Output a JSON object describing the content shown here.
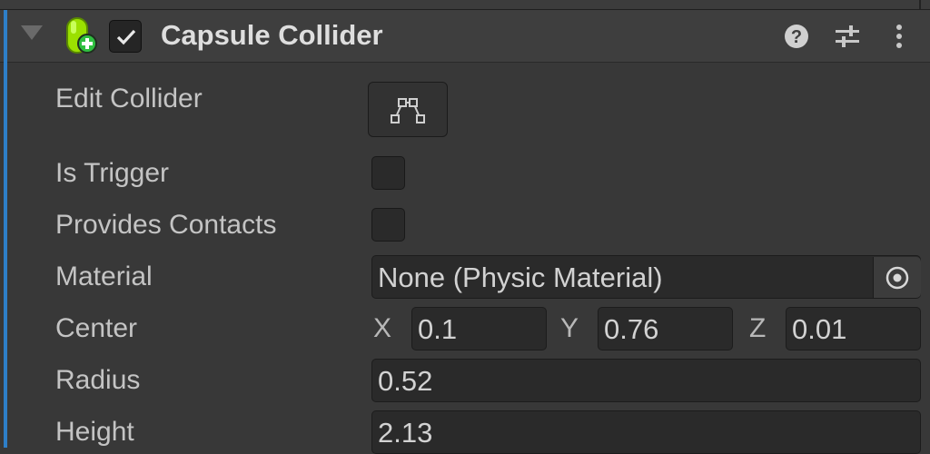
{
  "component": {
    "title": "Capsule Collider",
    "enabled": true,
    "header_icons": [
      "help-icon",
      "preset-sliders-icon",
      "more-options-icon"
    ]
  },
  "rows": {
    "edit_collider": {
      "label": "Edit Collider",
      "icon": "edit-collider-icon"
    },
    "is_trigger": {
      "label": "Is Trigger",
      "checked": false
    },
    "provides_contacts": {
      "label": "Provides Contacts",
      "checked": false
    },
    "material": {
      "label": "Material",
      "value": "None (Physic Material)",
      "icon": "object-picker-icon"
    },
    "center": {
      "label": "Center",
      "x_label": "X",
      "x": "0.1",
      "y_label": "Y",
      "y": "0.76",
      "z_label": "Z",
      "z": "0.01"
    },
    "radius": {
      "label": "Radius",
      "value": "0.52"
    },
    "height": {
      "label": "Height",
      "value": "2.13"
    }
  },
  "colors": {
    "accent": "#2e7fc8",
    "background": "#383838",
    "field": "#2a2a2a",
    "icon_green": "#8fd400"
  }
}
